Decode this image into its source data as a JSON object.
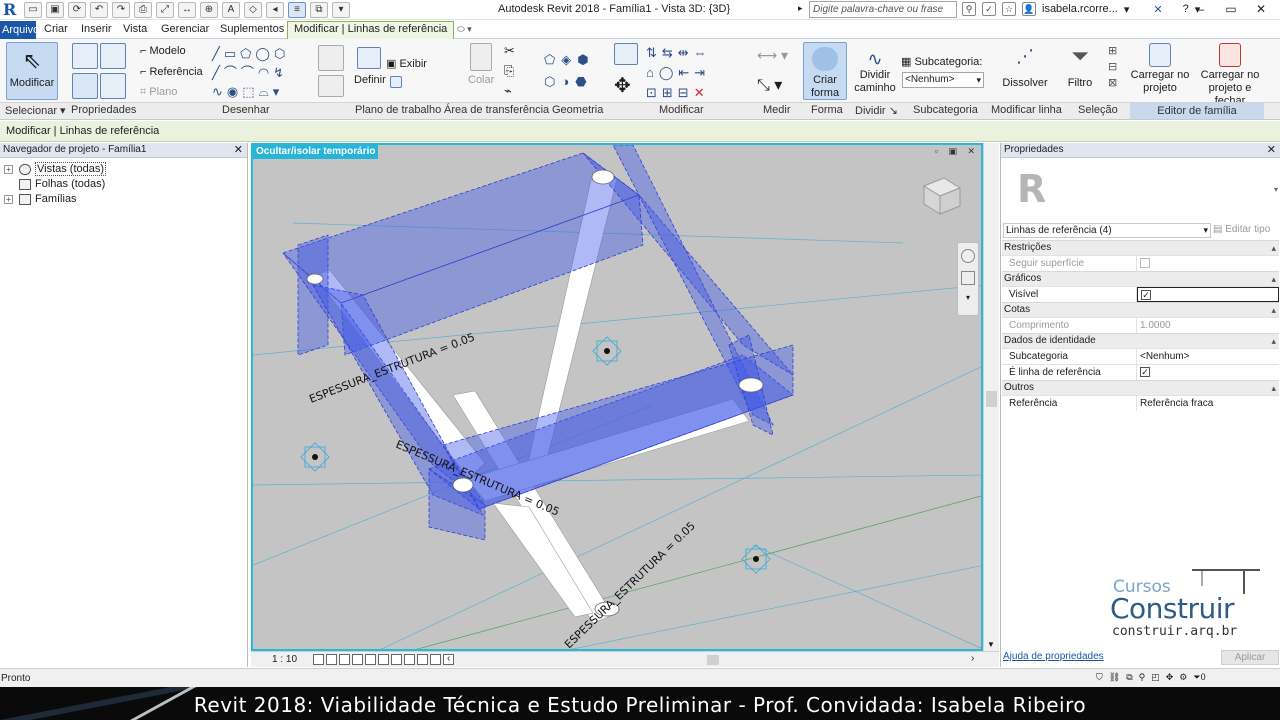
{
  "app": {
    "title": "Autodesk Revit 2018 -    Família1 - Vista 3D: {3D}",
    "search_placeholder": "Digite palavra-chave ou frase",
    "user": "isabela.rcorre...",
    "logo_letter": "R"
  },
  "tabs": [
    {
      "label": "Arquivo"
    },
    {
      "label": "Criar"
    },
    {
      "label": "Inserir"
    },
    {
      "label": "Vista"
    },
    {
      "label": "Gerenciar"
    },
    {
      "label": "Suplementos"
    },
    {
      "label": "Modificar | Linhas de referência"
    }
  ],
  "ribbon": {
    "modificar": "Modificar",
    "modelo": "Modelo",
    "referencia": "Referência",
    "plano": "Plano",
    "exibir": "Exibir",
    "definir": "Definir",
    "colar": "Colar",
    "criar_forma": "Criar\nforma",
    "criar_forma_l1": "Criar",
    "criar_forma_l2": "forma",
    "dividir_caminho_l1": "Dividir",
    "dividir_caminho_l2": "caminho",
    "subcategoria_label": "Subcategoria:",
    "subcategoria_value": "<Nenhum>",
    "dissolver": "Dissolver",
    "filtro": "Filtro",
    "carregar_l1": "Carregar no",
    "carregar_l2": "projeto",
    "carregar_fechar_l1": "Carregar no",
    "carregar_fechar_l2": "projeto e fechar",
    "panels": {
      "selecionar": "Selecionar ▾",
      "propriedades": "Propriedades",
      "desenhar": "Desenhar",
      "plano_trabalho": "Plano de trabalho",
      "area_transferencia": "Área de transferência",
      "geometria": "Geometria",
      "modificar": "Modificar",
      "medir": "Medir",
      "forma": "Forma",
      "dividir": "Dividir ↘",
      "subcategoria": "Subcategoria",
      "modificar_linha": "Modificar linha",
      "selecao": "Seleção",
      "editor_familia": "Editor de família"
    }
  },
  "options_bar": "Modificar | Linhas de referência",
  "project_browser": {
    "title": "Navegador de projeto - Família1",
    "items": [
      {
        "label": "Vistas (todas)"
      },
      {
        "label": "Folhas (todas)"
      },
      {
        "label": "Famílias"
      }
    ]
  },
  "viewport": {
    "tag": "Ocultar/isolar temporário",
    "scale": "1 : 10",
    "annotations": [
      "ESPESSURA_ESTRUTURA = 0.05",
      "ESPESSURA_ESTRUTURA = 0.05",
      "ESPESSURA_ESTRUTURA = 0.05"
    ],
    "colors": {
      "background": "#c4c4c4",
      "reference_fill": "#4058e8",
      "border": "#2ab8d8"
    }
  },
  "properties": {
    "title": "Propriedades",
    "type_selector": "Linhas de referência (4)",
    "edit_type": "Editar tipo",
    "groups": [
      {
        "name": "Restrições",
        "rows": [
          {
            "label": "Seguir superfície",
            "type": "checkbox",
            "checked": false,
            "disabled": true
          }
        ]
      },
      {
        "name": "Gráficos",
        "rows": [
          {
            "label": "Visível",
            "type": "checkbox",
            "checked": true
          }
        ]
      },
      {
        "name": "Cotas",
        "rows": [
          {
            "label": "Comprimento",
            "value": "1.0000",
            "disabled": true
          }
        ]
      },
      {
        "name": "Dados de identidade",
        "rows": [
          {
            "label": "Subcategoria",
            "value": "<Nenhum>"
          },
          {
            "label": "É linha de referência",
            "type": "checkbox",
            "checked": true
          }
        ]
      },
      {
        "name": "Outros",
        "rows": [
          {
            "label": "Referência",
            "value": "Referência fraca"
          }
        ]
      }
    ],
    "help_link": "Ajuda de propriedades",
    "apply": "Aplicar"
  },
  "status": {
    "text": "Pronto",
    "filter_count": "0"
  },
  "watermark": {
    "line1": "Cursos",
    "line2": "Construir",
    "url": "construir.arq.br"
  },
  "caption": "Revit 2018: Viabilidade Técnica e Estudo Preliminar - Prof. Convidada: Isabela Ribeiro"
}
